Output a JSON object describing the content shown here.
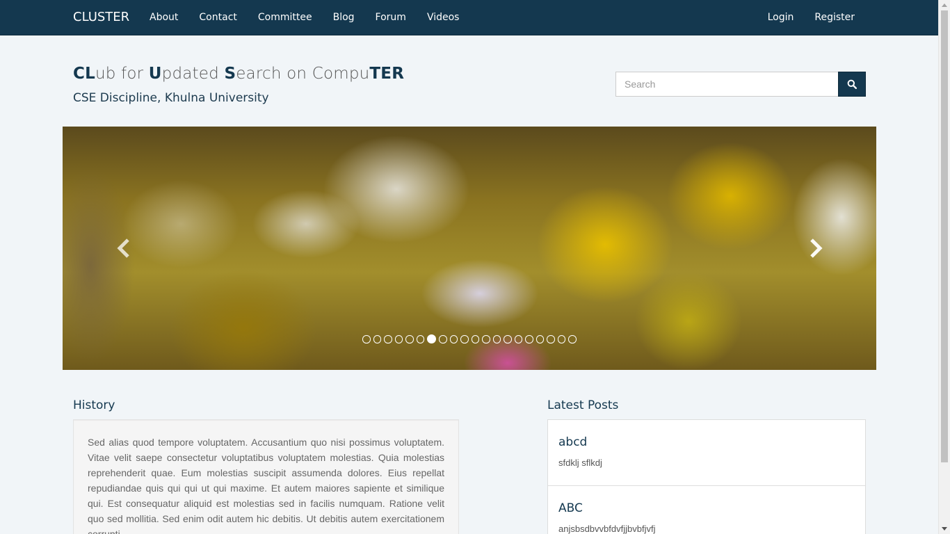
{
  "navbar": {
    "brand": "CLUSTER",
    "left_links": [
      "About",
      "Contact",
      "Committee",
      "Blog",
      "Forum",
      "Videos"
    ],
    "right_links": [
      "Login",
      "Register"
    ],
    "bg_color": "#14384f"
  },
  "header": {
    "title_parts": [
      {
        "text": "CL",
        "bold": true
      },
      {
        "text": "ub for ",
        "bold": false
      },
      {
        "text": "U",
        "bold": true
      },
      {
        "text": "pdated ",
        "bold": false
      },
      {
        "text": "S",
        "bold": true
      },
      {
        "text": "earch on Compu",
        "bold": false
      },
      {
        "text": "TER",
        "bold": true
      }
    ],
    "subtitle": "CSE Discipline, Khulna University"
  },
  "search": {
    "placeholder": "Search",
    "button_icon": "search-icon"
  },
  "carousel": {
    "indicator_count": 20,
    "active_index": 6,
    "prev_icon": "chevron-left-icon",
    "next_icon": "chevron-right-icon"
  },
  "history": {
    "title": "History",
    "text": "Sed alias quod tempore voluptatem. Accusantium quo nisi possimus voluptatem. Vitae velit saepe consectetur voluptatibus voluptatem molestias. Quia molestias reprehenderit quae. Eum molestias suscipit assumenda dolores. Eius repellat repudiandae quis qui qui ut qui maxime. Et autem maiores sapiente et similique qui. Est consequatur aliquid est molestias sed in facilis numquam. Ratione velit quo sed mollitia. Sed enim odit autem hic debitis. Ut debitis autem exercitationem corrupti."
  },
  "latest_posts": {
    "title": "Latest Posts",
    "items": [
      {
        "title": "abcd",
        "excerpt": "sfdklj  sflkdj"
      },
      {
        "title": "ABC",
        "excerpt": "anjsbsdbvvbfdvfjjbvbfjvfj"
      }
    ]
  }
}
